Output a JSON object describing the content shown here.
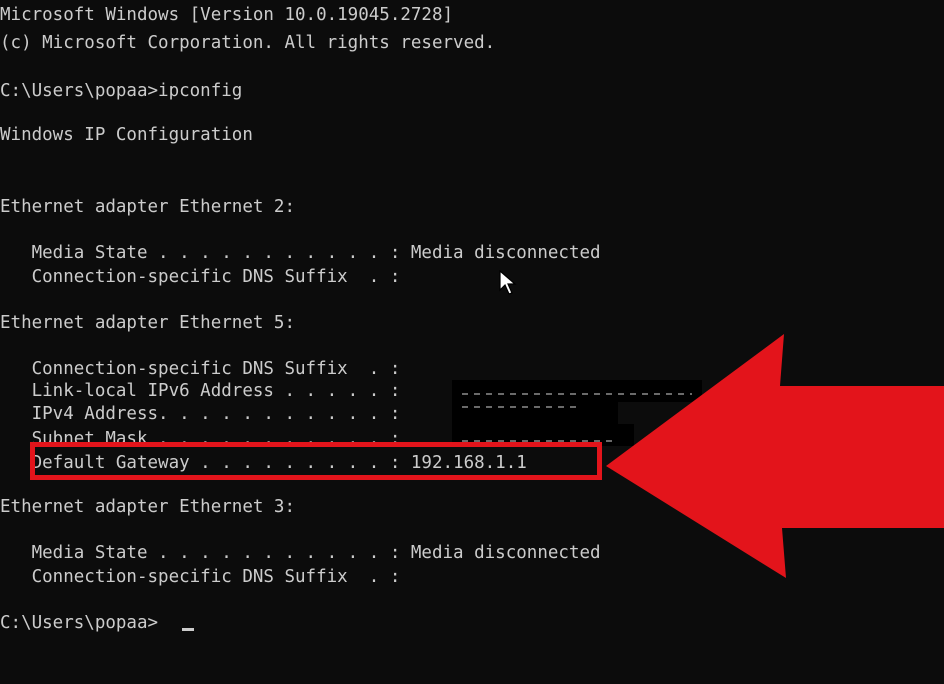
{
  "terminal": {
    "lines": [
      "Microsoft Windows [Version 10.0.19045.2728]",
      "(c) Microsoft Corporation. All rights reserved.",
      "C:\\Users\\popaa>ipconfig",
      "Windows IP Configuration",
      "Ethernet adapter Ethernet 2:",
      "   Media State . . . . . . . . . . . : Media disconnected",
      "   Connection-specific DNS Suffix  . :",
      "Ethernet adapter Ethernet 5:",
      "   Connection-specific DNS Suffix  . :",
      "   Link-local IPv6 Address . . . . . :",
      "   IPv4 Address. . . . . . . . . . . :",
      "   Subnet Mask . . . . . . . . . . . :",
      "   Default Gateway . . . . . . . . . : 192.168.1.1",
      "Ethernet adapter Ethernet 3:",
      "   Media State . . . . . . . . . . . : Media disconnected",
      "   Connection-specific DNS Suffix  . :",
      "C:\\Users\\popaa>"
    ]
  },
  "colors": {
    "background": "#0c0c0c",
    "text": "#cccccc",
    "annotation_red": "#e3141b"
  },
  "icons": {
    "mouse_pointer": "arrow-cursor-icon",
    "annotation": "left-arrow-icon"
  }
}
